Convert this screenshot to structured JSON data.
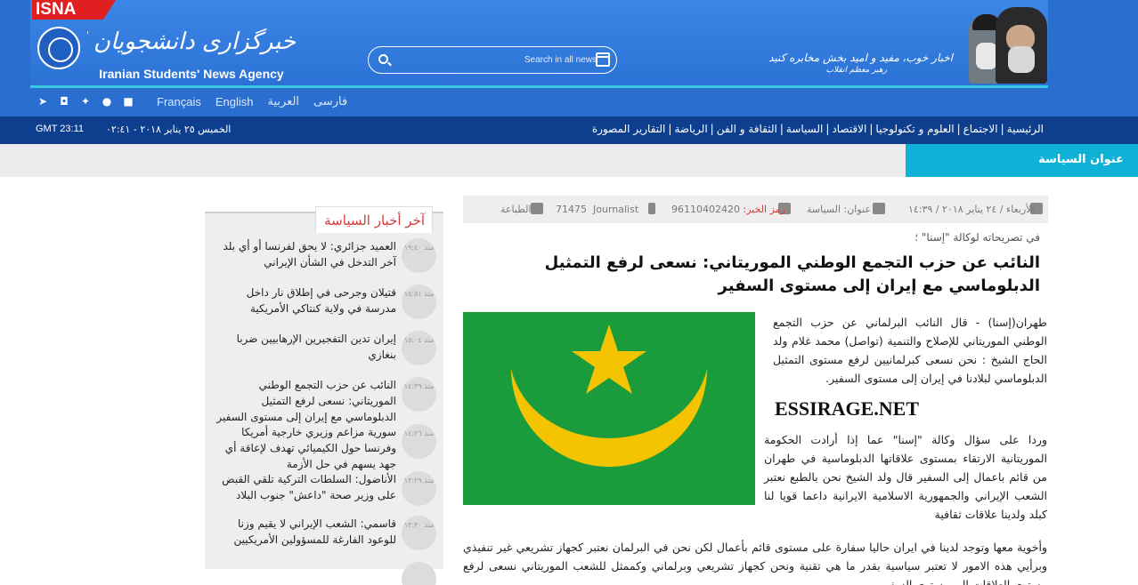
{
  "header": {
    "brand_tag": "ISNA",
    "logo_fa": "خبرگزاری دانشجویان ایران، ایسنا",
    "logo_en": "Iranian Students' News Agency",
    "search_placeholder": "Search in all news",
    "slogan": "اخبار خوب، مفید و امید بخش مخابره کنید",
    "slogan_sub": "رهبر معظم انقلاب",
    "languages": [
      "فارسی",
      "العربية",
      "English",
      "Français"
    ],
    "social_icons": [
      "telegram-icon",
      "instagram-icon",
      "twitter-icon",
      "apple-icon",
      "android-icon"
    ]
  },
  "navbar": {
    "clock": "GMT 23:11",
    "date": "الخميس ٢٥ يناير ٢٠١٨ - ٠٢:٤١",
    "items": [
      "الرئيسية",
      "الاجتماع",
      "العلوم و تكنولوجيا",
      "الاقتصاد",
      "السياسة",
      "الثقافة و الفن",
      "الرياضة",
      "التقارير المصورة"
    ]
  },
  "section": {
    "title": "عنوان السياسة"
  },
  "meta": {
    "date": "الأربعاء / ٢٤ يناير ٢٠١٨ / ١٤:٣٩",
    "section": "عنوان: السياسة",
    "code_label": "رمز الخبر:",
    "code": "96110402420",
    "journalist_label": "Journalist",
    "journalist_id": "71475",
    "print": "الطباعة"
  },
  "article": {
    "lead": "في تصريحاته لوكالة \"إسنا\" ؛",
    "headline": "النائب عن حزب التجمع الوطني الموريتاني: نسعى لرفع التمثيل الدبلوماسي مع إيران إلى مستوى السفير",
    "watermark": "ESSIRAGE.NET",
    "p1": "طهران(إسنا) - قال النائب البرلماني عن حزب التجمع الوطني الموريتاني للإصلاح والتنمية (تواصل) محمد غلام ولد الحاج الشيخ : نحن نسعى كبرلمانيين لرفع مستوى التمثيل الدبلوماسي لبلادنا في إيران إلى مستوى السفير.",
    "p2": "وردا على سؤال وكالة \"إسنا\" عما إذا أرادت الحكومة الموريتانية الارتقاء بمستوى علاقاتها الدبلوماسية في طهران من قائم باعمال إلى السفير قال ولد الشيخ نحن بالطبع نعتبر الشعب الإيراني والجمهورية الاسلامية الايرانية داعما قويا لنا كبلد ولدينا علاقات ثقافية",
    "p3": "وأخوية معها وتوجد لدينا في ايران حاليا سفارة على مستوى قائم بأعمال لكن نحن في البرلمان نعتبر كجهاز تشريعي غير تنفيذي وبرأيي هذه الامور لا تعتبر سياسية بقدر ما هي تقنية ونحن كجهاز تشريعي وبرلماني وكممثل للشعب الموريتاني نسعى لرفع مستوى العلاقات إلى مستوى السفير"
  },
  "sidebar": {
    "title": "آخر أخبار السياسة",
    "items": [
      {
        "time": "منذ ١٩:٤٠",
        "text": "العميد جزائري: لا يحق لفرنسا أو أي بلد آخر التدخل في الشأن الإيراني"
      },
      {
        "time": "منذ ١٥:٥١",
        "text": "قتيلان وجرحى في إطلاق نار داخل مدرسة في ولاية كنتاكي الأمريكية"
      },
      {
        "time": "منذ ١٥:٠٤",
        "text": "إيران تدين التفجيرين الإرهابيين ضربا بنغازي"
      },
      {
        "time": "منذ ١٤:٣٩",
        "text": "النائب عن حزب التجمع الوطني الموريتاني: نسعى لرفع التمثيل الدبلوماسي مع إيران إلى مستوى السفير"
      },
      {
        "time": "منذ ١٤:٢٦",
        "text": "سورية مزاعم وزيري خارجية أمريكا وفرنسا حول الكيميائي تهدف لإعاقة أي جهد يسهم في حل الأزمة"
      },
      {
        "time": "منذ ١٣:٢٩",
        "text": "الأناضول: السلطات التركية تلقي القبض على وزير صحة \"داعش\" جنوب البلاد"
      },
      {
        "time": "منذ ١٣:٣٠",
        "text": "قاسمي: الشعب الإيراني لا يقيم وزنا للوعود الفارغة للمسؤولين الأمريكيين"
      }
    ]
  }
}
